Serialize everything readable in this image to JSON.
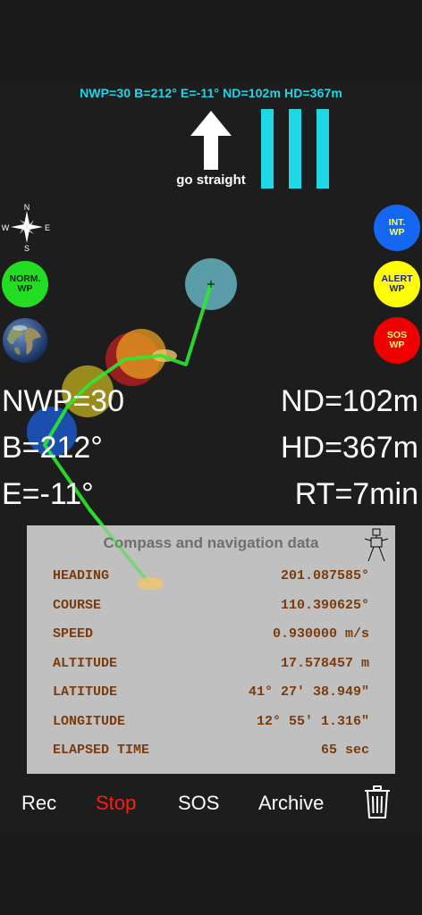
{
  "status_line": "NWP=30 B=212° E=-11° ND=102m HD=367m",
  "direction": {
    "text": "go straight",
    "icon": "arrow-up-icon"
  },
  "compass_rose": {
    "n": "N",
    "e": "E",
    "s": "S",
    "w": "W"
  },
  "buttons": {
    "norm_wp": {
      "l1": "NORM.",
      "l2": "WP",
      "color": "#22dd22"
    },
    "int_wp": {
      "l1": "INT.",
      "l2": "WP",
      "color": "#1566f0"
    },
    "alert_wp": {
      "l1": "ALERT",
      "l2": "WP",
      "color": "#ffff00"
    },
    "sos_wp": {
      "l1": "SOS",
      "l2": "WP",
      "color": "#ee0000"
    }
  },
  "readouts": {
    "nwp": "NWP=30",
    "bearing": "B=212°",
    "elevation": "E=-11°",
    "nd": "ND=102m",
    "hd": "HD=367m",
    "rt": "RT=7min"
  },
  "panel": {
    "title": "Compass and navigation data",
    "rows": [
      {
        "label": "HEADING",
        "value": "201.087585°"
      },
      {
        "label": "COURSE",
        "value": "110.390625°"
      },
      {
        "label": "SPEED",
        "value": "0.930000 m/s"
      },
      {
        "label": "ALTITUDE",
        "value": "17.578457 m"
      },
      {
        "label": "LATITUDE",
        "value": "41° 27' 38.949\""
      },
      {
        "label": "LONGITUDE",
        "value": "12° 55' 1.316\""
      },
      {
        "label": "ELAPSED TIME",
        "value": "65 sec"
      }
    ]
  },
  "toolbar": {
    "rec": "Rec",
    "stop": "Stop",
    "sos": "SOS",
    "archive": "Archive",
    "stop_color": "#ff1a1a",
    "trash_icon": "trash-icon"
  },
  "colors": {
    "accent": "#21d4e3",
    "track": "#2ee82e"
  }
}
